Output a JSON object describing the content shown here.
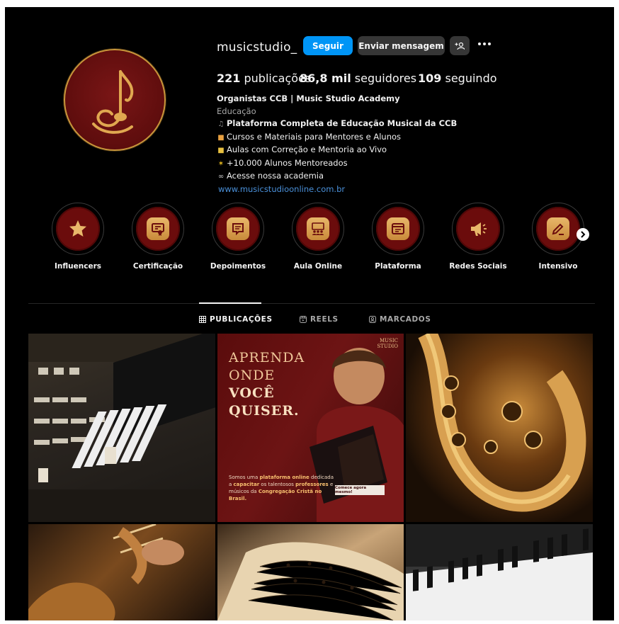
{
  "profile": {
    "username": "musicstudio_",
    "follow_label": "Seguir",
    "message_label": "Enviar mensagem",
    "add_user_label": "+♀",
    "more_label": "•••",
    "stats": {
      "posts_count": "221",
      "posts_label": "publicações",
      "followers_count": "86,8 mil",
      "followers_label": "seguidores",
      "following_count": "109",
      "following_label": "seguindo"
    },
    "bio": {
      "name": "Organistas CCB | Music Studio Academy",
      "category": "Educação",
      "line1": "Plataforma Completa de Educação Musical da CCB",
      "line2": "Cursos e Materiais para Mentores e Alunos",
      "line3": "Aulas com Correção e Mentoria ao Vivo",
      "line4": "+10.000 Alunos Mentoreados",
      "line5": "Acesse nossa academia",
      "link": "www.musicstudioonline.com.br"
    }
  },
  "highlights": [
    {
      "label": "Influencers",
      "icon": "star-icon"
    },
    {
      "label": "Certificação",
      "icon": "certificate-icon"
    },
    {
      "label": "Depoimentos",
      "icon": "comment-icon"
    },
    {
      "label": "Aula Online",
      "icon": "people-icon"
    },
    {
      "label": "Plataforma",
      "icon": "browser-icon"
    },
    {
      "label": "Redes Sociais",
      "icon": "megaphone-icon"
    },
    {
      "label": "Intensivo",
      "icon": "edit-icon"
    }
  ],
  "tabs": [
    {
      "label": "PUBLICAÇÕES",
      "active": true
    },
    {
      "label": "REELS",
      "active": false
    },
    {
      "label": "MARCADOS",
      "active": false
    }
  ],
  "posts": {
    "featured": {
      "line1": "APRENDA",
      "line2": "ONDE",
      "line3": "VOCÊ",
      "line4": "QUISER.",
      "brand_line1": "MUSIC",
      "brand_line2": "STUDIO",
      "desc_a": "Somos uma ",
      "desc_b": "plataforma online",
      "desc_c": " dedicada a ",
      "desc_d": "capacitar",
      "desc_e": " os talentosos ",
      "desc_f": "professores",
      "desc_g": " e músicos da ",
      "desc_h": "Congregação Cristã no Brasil.",
      "cta": "Comece agora mesmo!"
    }
  },
  "colors": {
    "accent_blue": "#0095f6",
    "brand_red": "#6b0c0c",
    "brand_gold": "#c9963b"
  }
}
